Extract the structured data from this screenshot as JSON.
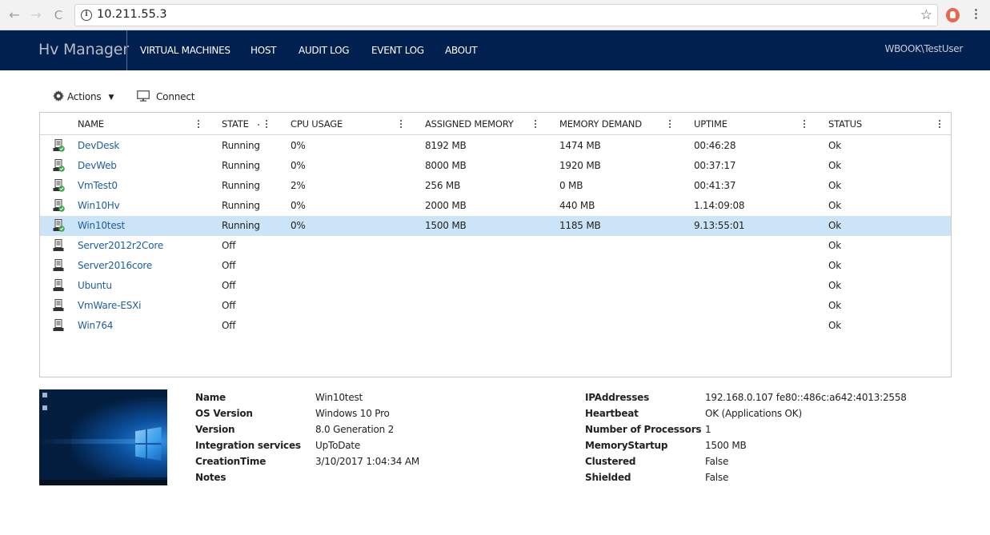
{
  "browser": {
    "url": "10.211.55.3",
    "back_label": "←",
    "forward_label": "→",
    "reload_label": "C",
    "info_label": "i",
    "star_label": "☆"
  },
  "header": {
    "brand": "Hv Manager",
    "nav": [
      {
        "label": "VIRTUAL MACHINES"
      },
      {
        "label": "HOST"
      },
      {
        "label": "AUDIT LOG"
      },
      {
        "label": "EVENT LOG"
      },
      {
        "label": "ABOUT"
      }
    ],
    "user": "WBOOK\\TestUser"
  },
  "toolbar": {
    "actions_label": "Actions",
    "actions_caret": "▼",
    "connect_label": "Connect"
  },
  "grid": {
    "columns": [
      {
        "label": "NAME"
      },
      {
        "label": "STATE"
      },
      {
        "label": "CPU USAGE"
      },
      {
        "label": "ASSIGNED MEMORY"
      },
      {
        "label": "MEMORY DEMAND"
      },
      {
        "label": "UPTIME"
      },
      {
        "label": "STATUS"
      }
    ],
    "rows": [
      {
        "name": "DevDesk",
        "state": "Running",
        "cpu": "0%",
        "assigned": "8192 MB",
        "demand": "1474 MB",
        "uptime": "00:46:28",
        "status": "Ok",
        "running": true
      },
      {
        "name": "DevWeb",
        "state": "Running",
        "cpu": "0%",
        "assigned": "8000 MB",
        "demand": "1920 MB",
        "uptime": "00:37:17",
        "status": "Ok",
        "running": true
      },
      {
        "name": "VmTest0",
        "state": "Running",
        "cpu": "2%",
        "assigned": "256 MB",
        "demand": "0 MB",
        "uptime": "00:41:37",
        "status": "Ok",
        "running": true
      },
      {
        "name": "Win10Hv",
        "state": "Running",
        "cpu": "0%",
        "assigned": "2000 MB",
        "demand": "440 MB",
        "uptime": "1.14:09:08",
        "status": "Ok",
        "running": true
      },
      {
        "name": "Win10test",
        "state": "Running",
        "cpu": "0%",
        "assigned": "1500 MB",
        "demand": "1185 MB",
        "uptime": "9.13:55:01",
        "status": "Ok",
        "running": true,
        "selected": true
      },
      {
        "name": "Server2012r2Core",
        "state": "Off",
        "cpu": "",
        "assigned": "",
        "demand": "",
        "uptime": "",
        "status": "Ok",
        "running": false
      },
      {
        "name": "Server2016core",
        "state": "Off",
        "cpu": "",
        "assigned": "",
        "demand": "",
        "uptime": "",
        "status": "Ok",
        "running": false
      },
      {
        "name": "Ubuntu",
        "state": "Off",
        "cpu": "",
        "assigned": "",
        "demand": "",
        "uptime": "",
        "status": "Ok",
        "running": false
      },
      {
        "name": "VmWare-ESXi",
        "state": "Off",
        "cpu": "",
        "assigned": "",
        "demand": "",
        "uptime": "",
        "status": "Ok",
        "running": false
      },
      {
        "name": "Win764",
        "state": "Off",
        "cpu": "",
        "assigned": "",
        "demand": "",
        "uptime": "",
        "status": "Ok",
        "running": false
      }
    ]
  },
  "details": {
    "left": [
      {
        "label": "Name",
        "value": "Win10test"
      },
      {
        "label": "OS Version",
        "value": "Windows 10 Pro"
      },
      {
        "label": "Version",
        "value": "8.0 Generation 2"
      },
      {
        "label": "Integration services",
        "value": "UpToDate"
      },
      {
        "label": "CreationTime",
        "value": "3/10/2017 1:04:34 AM"
      },
      {
        "label": "Notes",
        "value": ""
      }
    ],
    "right": [
      {
        "label": "IPAddresses",
        "value": "192.168.0.107 fe80::486c:a642:4013:2558"
      },
      {
        "label": "Heartbeat",
        "value": "OK (Applications OK)"
      },
      {
        "label": "Number of Processors",
        "value": "1"
      },
      {
        "label": "MemoryStartup",
        "value": "1500 MB"
      },
      {
        "label": "Clustered",
        "value": "False"
      },
      {
        "label": "Shielded",
        "value": "False"
      }
    ]
  },
  "colors": {
    "header_bg": "#002050",
    "link": "#1d5fa0",
    "selected_row": "#cce4f7",
    "status_ok_badge": "#3aa84a"
  }
}
